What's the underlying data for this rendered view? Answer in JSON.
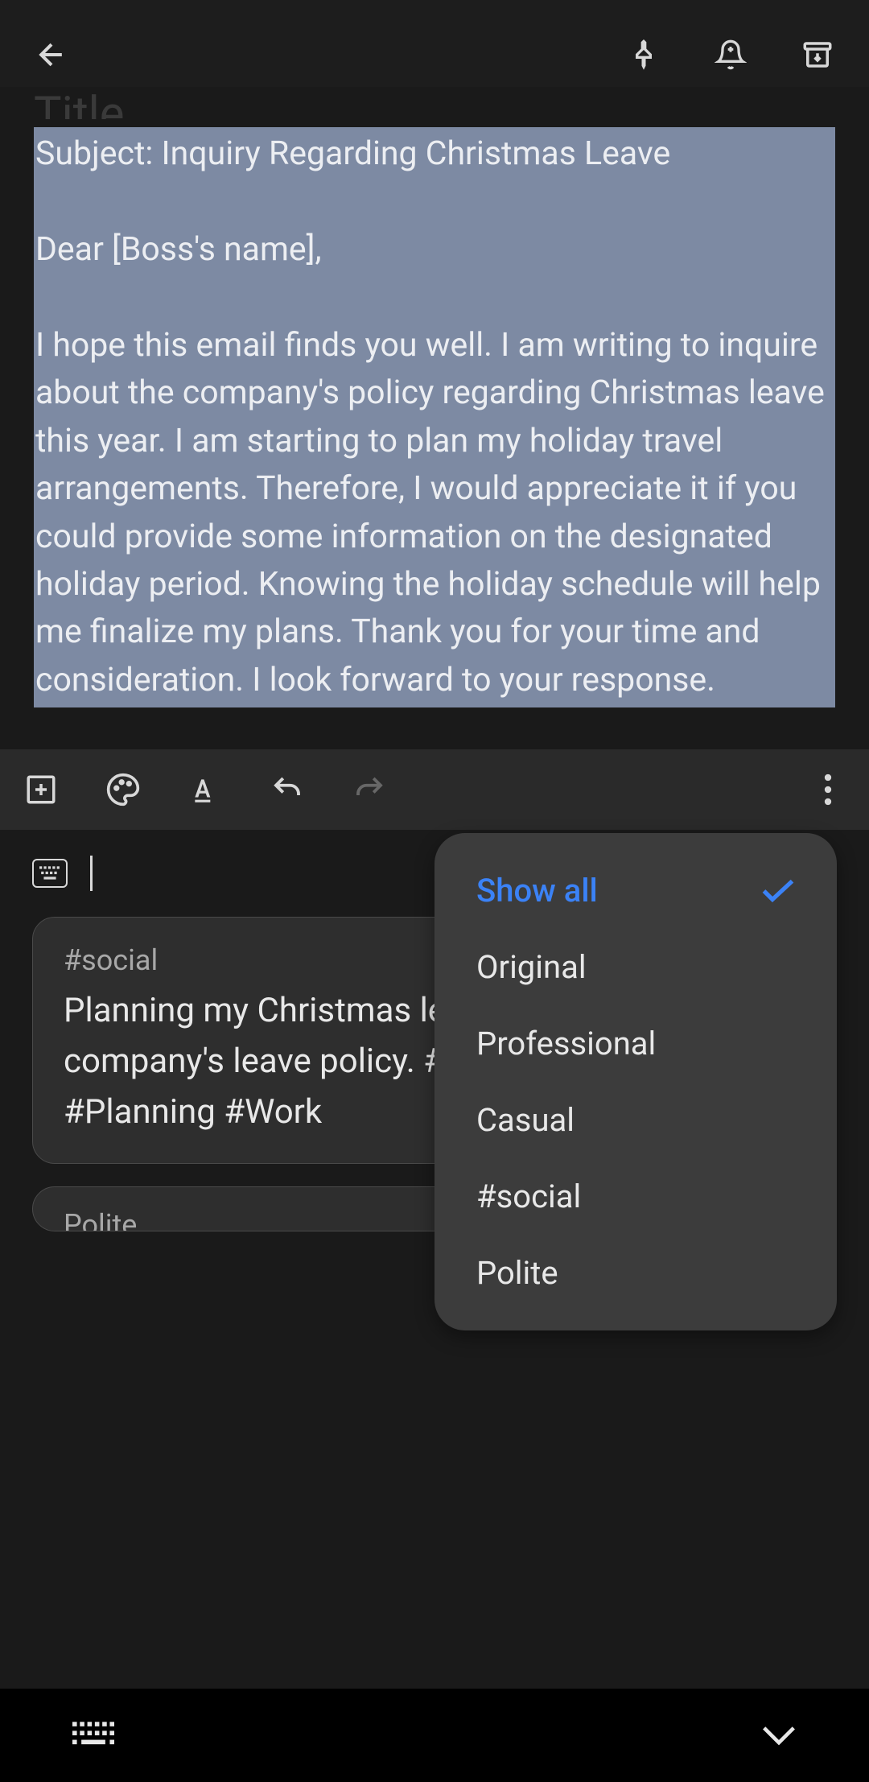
{
  "header": {
    "back_icon": "arrow-back",
    "pin_icon": "pin",
    "reminder_icon": "bell-add",
    "archive_icon": "archive"
  },
  "title_placeholder": "Title",
  "email": {
    "subject_line": "Subject: Inquiry Regarding Christmas Leave",
    "greeting": "Dear [Boss's name],",
    "body": "I hope this email finds you well. I am writing to inquire about the company's policy regarding Christmas leave this year.  I am starting to plan my holiday travel arrangements. Therefore, I would appreciate it if you could provide some information on the designated holiday period.  Knowing the holiday schedule will help me finalize my plans. Thank you for your time and consideration. I look forward to your response."
  },
  "toolbar": {
    "add_icon": "add-box",
    "palette_icon": "palette",
    "text_icon": "text-format",
    "undo_icon": "undo",
    "redo_icon": "redo",
    "more_icon": "more-vert"
  },
  "suggestions": {
    "card1": {
      "tag": "#social",
      "text": "Planning my Christmas leave travel! ✈️🎄  Need company's leave policy. #Leave #Christmas #Planning #Work"
    },
    "card2": {
      "tag": "Polite"
    }
  },
  "dropdown": {
    "selected": "Show all",
    "items": [
      "Show all",
      "Original",
      "Professional",
      "Casual",
      "#social",
      "Polite"
    ]
  },
  "bottom": {
    "keyboard_icon": "keyboard",
    "collapse_icon": "chevron-down"
  }
}
